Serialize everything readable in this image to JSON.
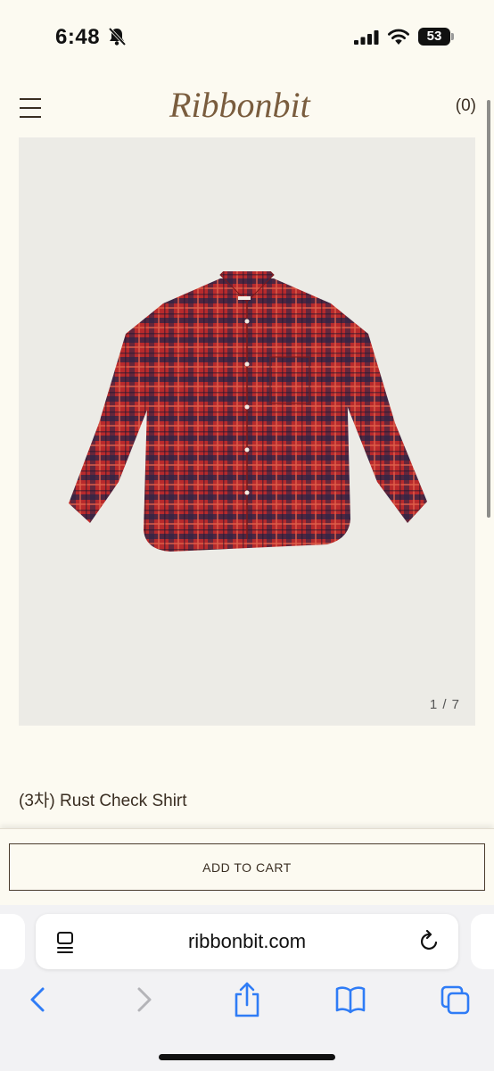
{
  "status_bar": {
    "time": "6:48",
    "battery_level": "53"
  },
  "header": {
    "logo_text": "Ribbonbit",
    "cart_count": "(0)"
  },
  "product": {
    "image_counter": "1 / 7",
    "title": "(3차) Rust Check Shirt"
  },
  "cart_bar": {
    "add_to_cart_label": "ADD TO CART"
  },
  "browser": {
    "url": "ribbonbit.com"
  },
  "colors": {
    "page_background": "#fcfaf1",
    "brand_brown": "#7a5d3e",
    "shirt_red": "#b82a2c",
    "image_background": "#ecebe6",
    "ios_accent": "#2f7cf6"
  }
}
